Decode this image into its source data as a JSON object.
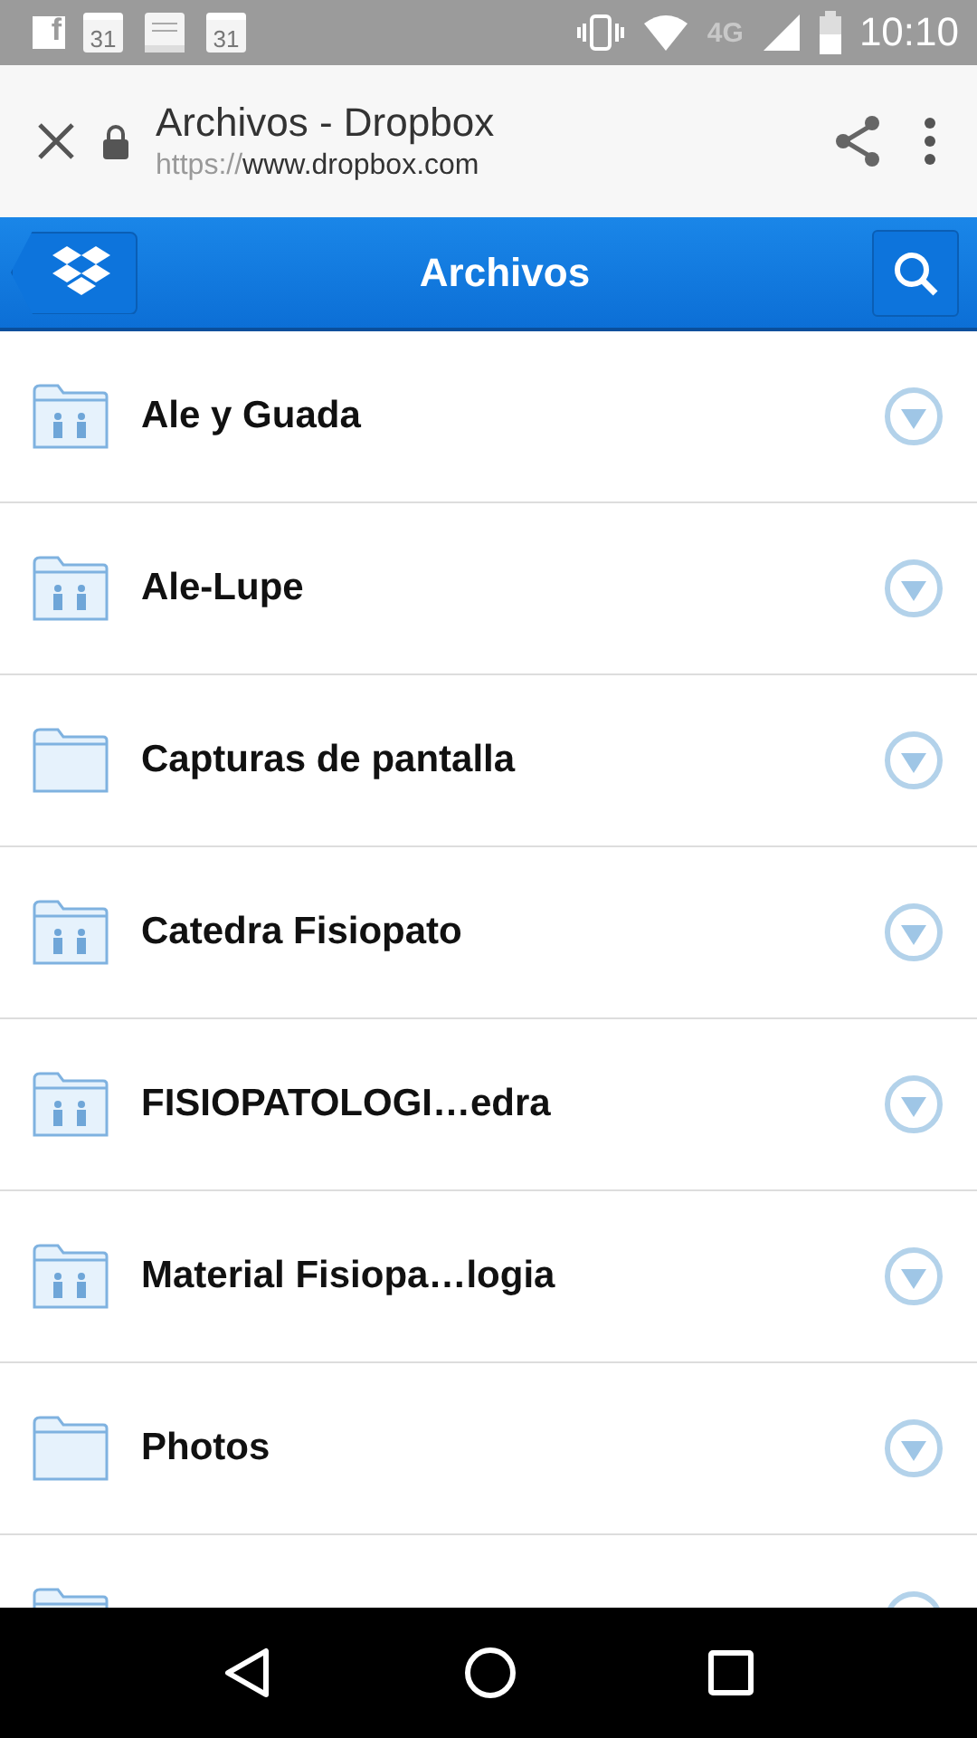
{
  "status_bar": {
    "notifications": [
      {
        "kind": "facebook",
        "text": "f"
      },
      {
        "kind": "calendar",
        "text": "31"
      },
      {
        "kind": "book"
      },
      {
        "kind": "calendar",
        "text": "31"
      }
    ],
    "network": "4G",
    "time": "10:10"
  },
  "browser_bar": {
    "title": "Archivos - Dropbox",
    "url_scheme": "https://",
    "url_host": "www.dropbox.com"
  },
  "header": {
    "title": "Archivos"
  },
  "files": [
    {
      "kind": "folder",
      "name": "Ale y Guada",
      "shared": true
    },
    {
      "kind": "folder",
      "name": "Ale-Lupe",
      "shared": true
    },
    {
      "kind": "folder",
      "name": "Capturas de pantalla",
      "shared": false
    },
    {
      "kind": "folder",
      "name": "Catedra Fisiopato",
      "shared": true
    },
    {
      "kind": "folder",
      "name": "FISIOPATOLOGI…edra",
      "shared": true
    },
    {
      "kind": "folder",
      "name": "Material Fisiopa…logia",
      "shared": true
    },
    {
      "kind": "folder",
      "name": "Photos",
      "shared": false
    },
    {
      "kind": "cut_off"
    }
  ]
}
